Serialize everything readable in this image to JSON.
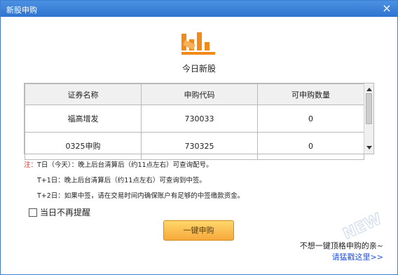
{
  "window": {
    "title": "新股申购",
    "close_icon": "×"
  },
  "logo": {
    "label": "今日新股",
    "accent": "#f28a18"
  },
  "table": {
    "headers": [
      "证券名称",
      "申购代码",
      "可申购数量"
    ],
    "rows": [
      [
        "福高增发",
        "730033",
        "0"
      ],
      [
        "0325申购",
        "730325",
        "0"
      ]
    ]
  },
  "notes": {
    "prefix": "注：",
    "line1": "T日（今天）：晚上后台清算后（约11点左右）可查询配号。",
    "line2": "T+1日：晚上后台清算后（约11点左右）可查询到中签。",
    "line3": "T+2日：如果中签，请在交易时间内确保账户有足够的中签缴款资金。"
  },
  "checkbox": {
    "label": "当日不再提醒",
    "checked": false
  },
  "button": {
    "label": "一键申购"
  },
  "footer": {
    "tip": "不想一键顶格申购的亲~",
    "link": "请猛戳这里>>"
  },
  "watermark": {
    "text": "NEW"
  }
}
